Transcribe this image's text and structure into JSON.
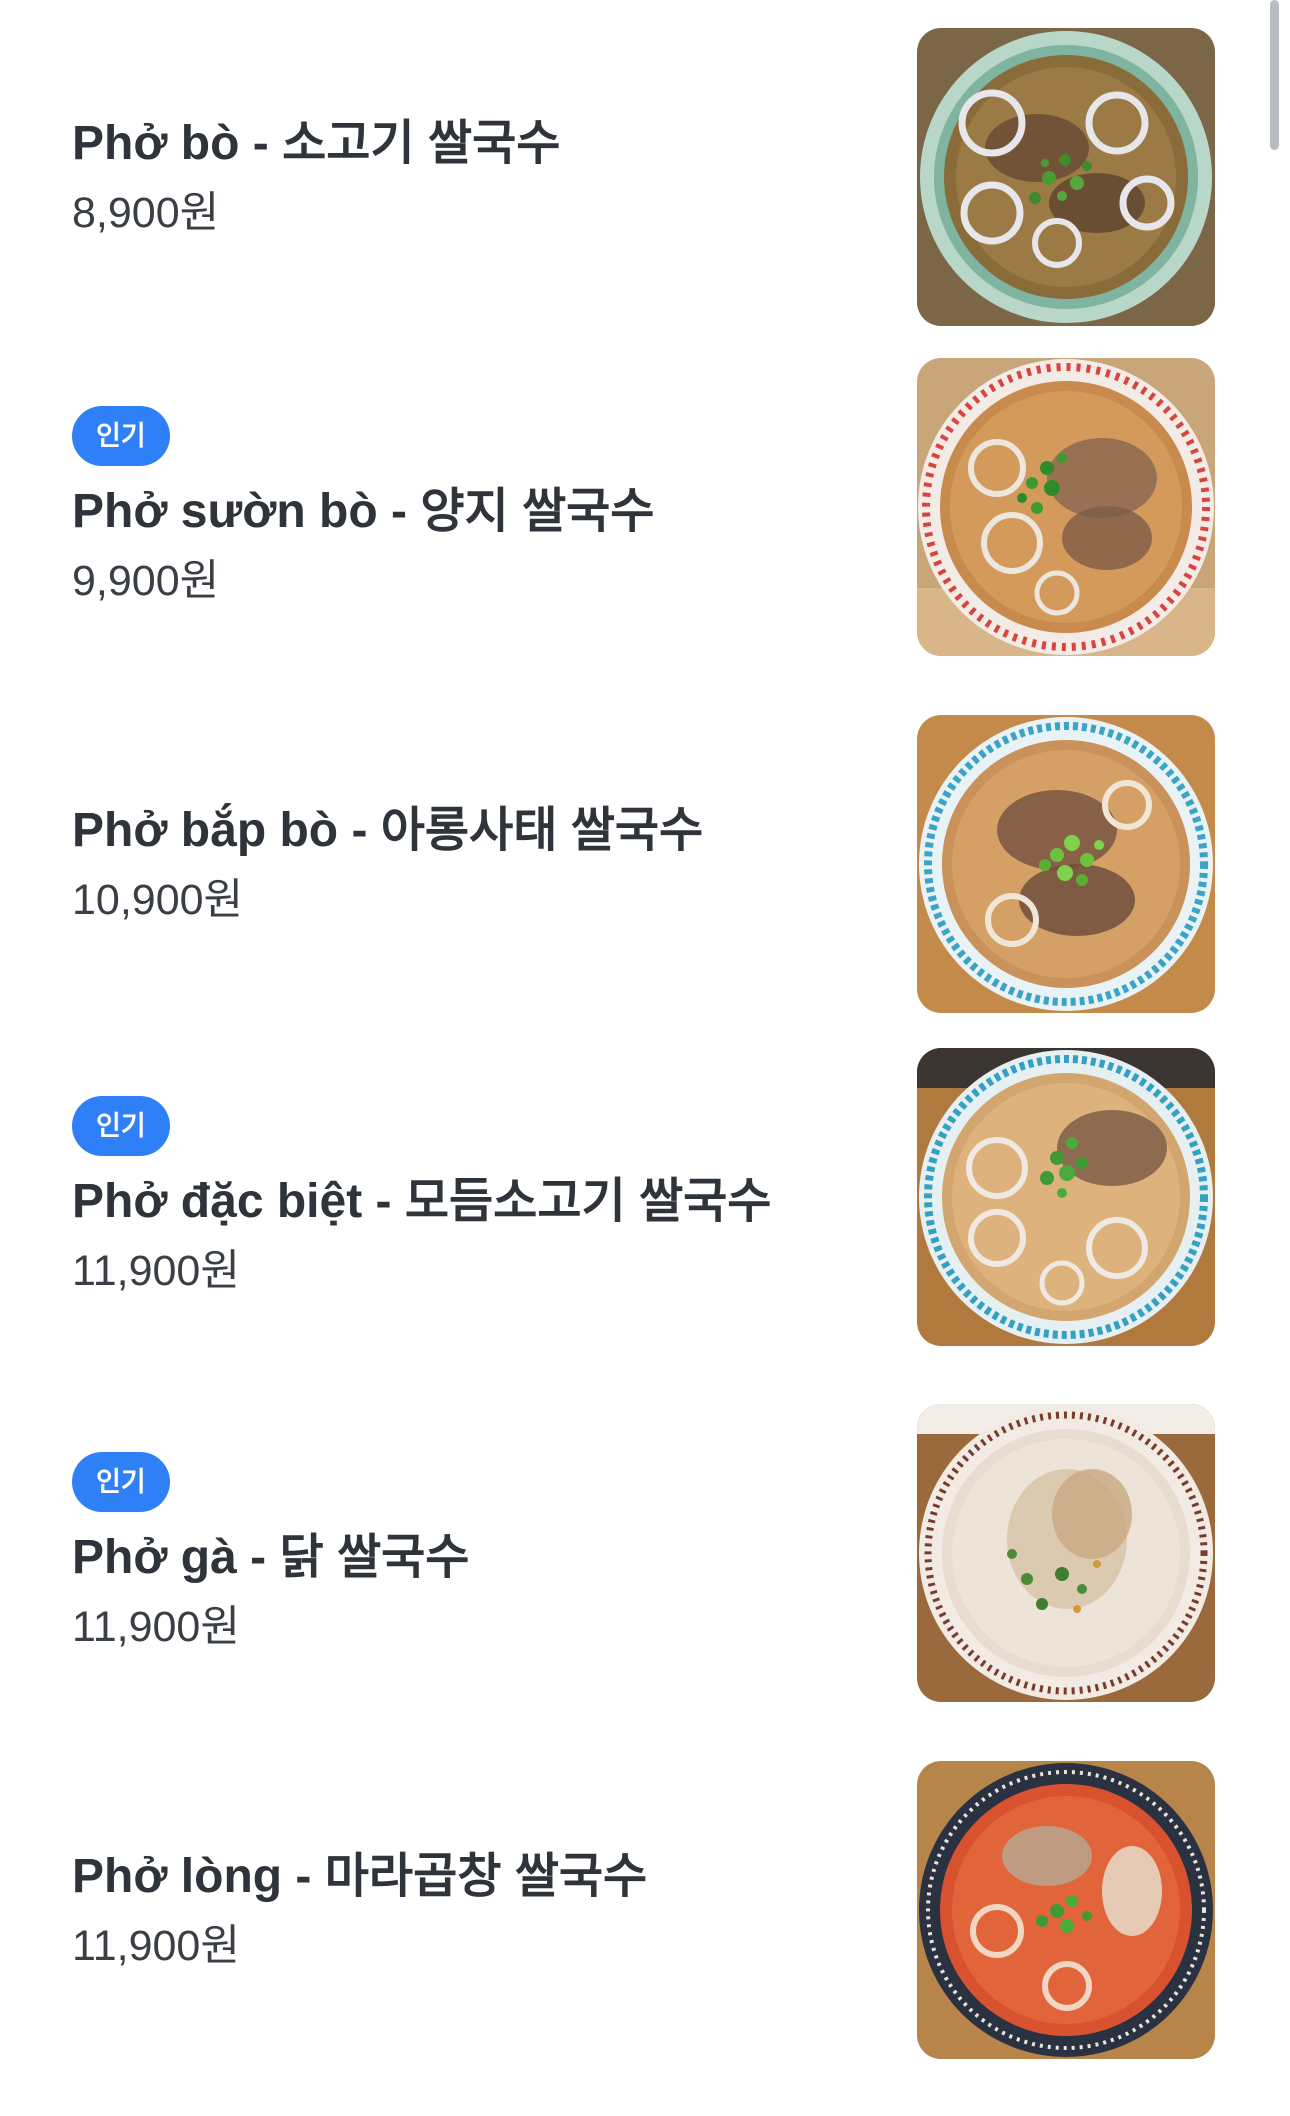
{
  "menu": {
    "items": [
      {
        "name": "Phở bò - 소고기 쌀국수",
        "price": "8,900원",
        "badge": "",
        "image": "pho-bo-bowl"
      },
      {
        "name": "Phở sườn bò - 양지 쌀국수",
        "price": "9,900원",
        "badge": "인기",
        "image": "pho-suon-bo-bowl"
      },
      {
        "name": "Phở bắp bò - 아롱사태 쌀국수",
        "price": "10,900원",
        "badge": "",
        "image": "pho-bap-bo-bowl"
      },
      {
        "name": "Phở đặc biệt - 모듬소고기 쌀국수",
        "price": "11,900원",
        "badge": "인기",
        "image": "pho-dac-biet-bowl"
      },
      {
        "name": "Phở gà - 닭 쌀국수",
        "price": "11,900원",
        "badge": "인기",
        "image": "pho-ga-bowl"
      },
      {
        "name": "Phở lòng - 마라곱창 쌀국수",
        "price": "11,900원",
        "badge": "",
        "image": "pho-long-bowl"
      }
    ]
  },
  "colors": {
    "badge_bg": "#2f80f6",
    "text_primary": "#2f333a",
    "text_price": "#3a3e45",
    "scrollbar": "#b9bcc1"
  }
}
